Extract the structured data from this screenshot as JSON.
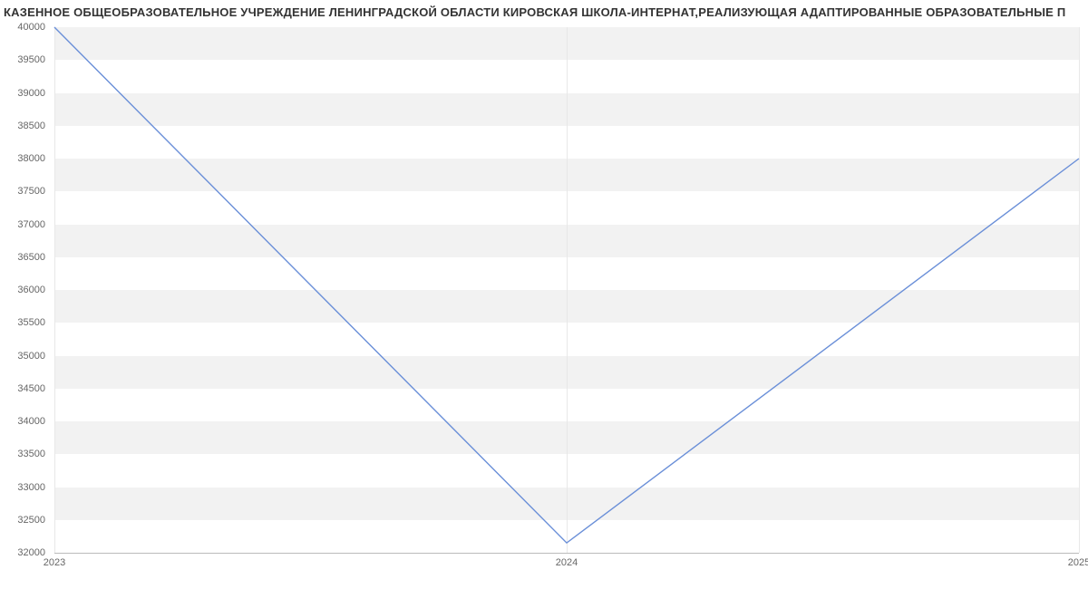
{
  "chart_data": {
    "type": "line",
    "title": "КАЗЕННОЕ ОБЩЕОБРАЗОВАТЕЛЬНОЕ УЧРЕЖДЕНИЕ ЛЕНИНГРАДСКОЙ ОБЛАСТИ КИРОВСКАЯ ШКОЛА-ИНТЕРНАТ,РЕАЛИЗУЮЩАЯ АДАПТИРОВАННЫЕ ОБРАЗОВАТЕЛЬНЫЕ П",
    "x": [
      2023,
      2024,
      2025
    ],
    "values": [
      40000,
      32150,
      38000
    ],
    "xlabel": "",
    "ylabel": "",
    "ylim": [
      32000,
      40000
    ],
    "y_ticks": [
      32000,
      32500,
      33000,
      33500,
      34000,
      34500,
      35000,
      35500,
      36000,
      36500,
      37000,
      37500,
      38000,
      38500,
      39000,
      39500,
      40000
    ],
    "x_ticks": [
      "2023",
      "2024",
      "2025"
    ]
  }
}
